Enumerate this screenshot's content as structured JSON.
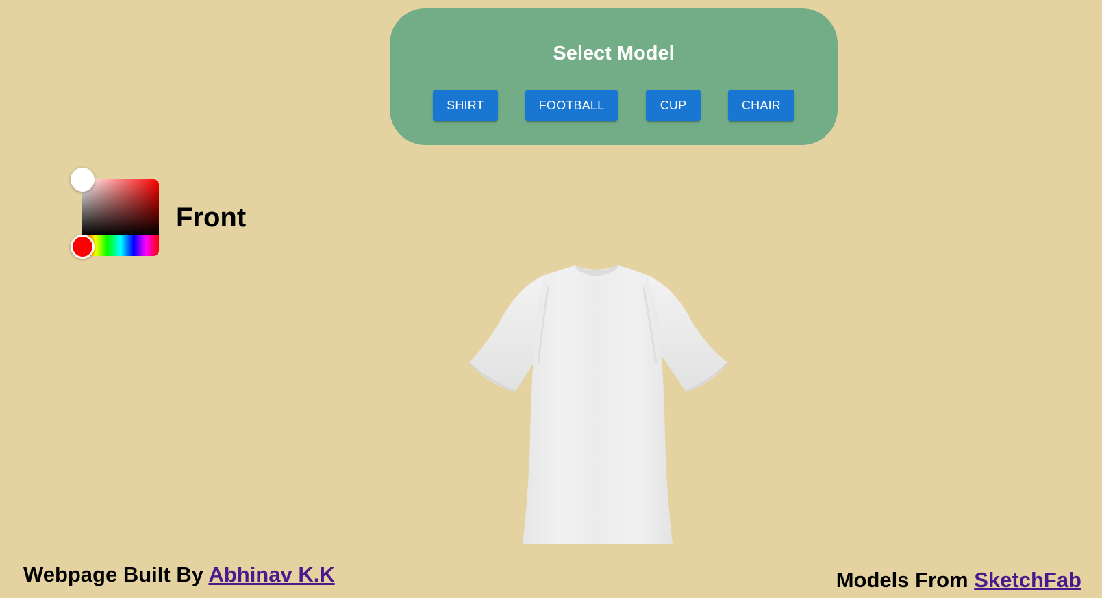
{
  "model_panel": {
    "title": "Select Model",
    "buttons": [
      "SHIRT",
      "FOOTBALL",
      "CUP",
      "CHAIR"
    ]
  },
  "color_picker": {
    "selected_color": "#ffffff",
    "hue_color": "#ff0000"
  },
  "side_label": "Front",
  "viewport": {
    "model": "shirt",
    "model_color": "#eeeeee"
  },
  "footer": {
    "left_prefix": "Webpage Built By",
    "left_link": "Abhinav K.K",
    "right_prefix": "Models From",
    "right_link": "SketchFab"
  },
  "colors": {
    "background": "#e4d3a1",
    "panel": "#72ad88",
    "button": "#1976d2",
    "link": "#4a1a8c"
  }
}
